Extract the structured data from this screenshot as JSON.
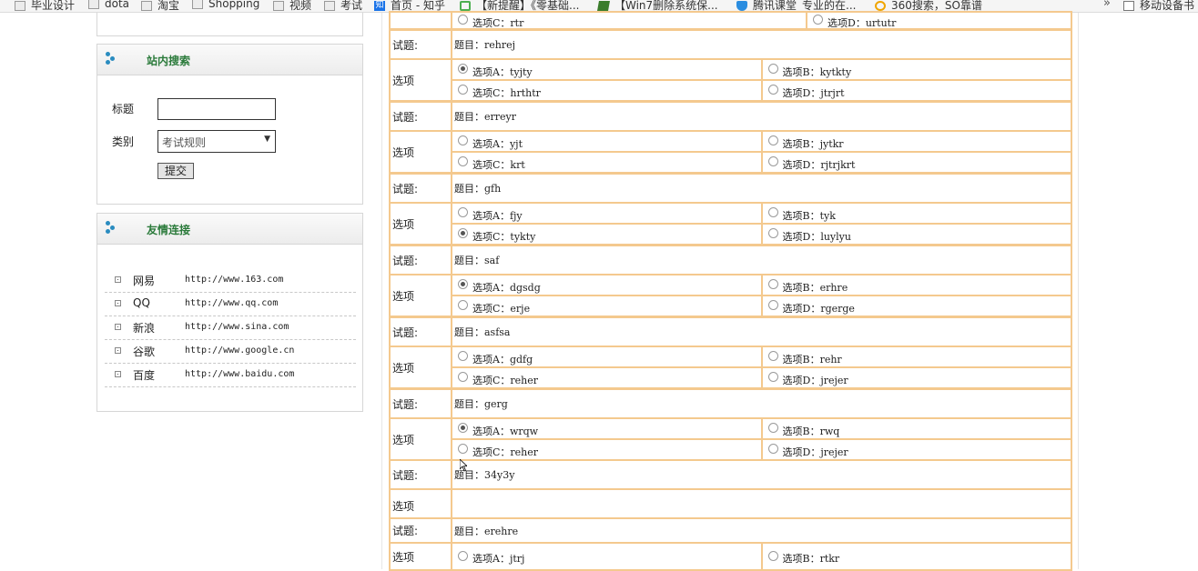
{
  "bookmarks": [
    {
      "label": "毕业设计",
      "icon": "folder-icon"
    },
    {
      "label": "dota",
      "icon": "folder-icon"
    },
    {
      "label": "淘宝",
      "icon": "folder-icon"
    },
    {
      "label": "Shopping",
      "icon": "folder-icon"
    },
    {
      "label": "视频",
      "icon": "folder-icon"
    },
    {
      "label": "考试",
      "icon": "folder-icon"
    },
    {
      "label": "首页 - 知乎",
      "icon": "zhihu-icon"
    },
    {
      "label": "【新提醒】《零基础...",
      "icon": "g-icon"
    },
    {
      "label": "【Win7删除系统保...",
      "icon": "z-icon"
    },
    {
      "label": "腾讯课堂_专业的在...",
      "icon": "shield-icon"
    },
    {
      "label": "360搜索，SO靠谱",
      "icon": "ring-icon"
    }
  ],
  "bookmarks_more": "»",
  "mobile_bookmarks": "移动设备书",
  "search_panel": {
    "title": "站内搜索",
    "title_label": "标题",
    "title_value": "",
    "category_label": "类别",
    "category_value": "考试规则",
    "submit_label": "提交"
  },
  "links_panel": {
    "title": "友情连接",
    "links": [
      {
        "name": "网易",
        "url": "http://www.163.com"
      },
      {
        "name": "QQ",
        "url": "http://www.qq.com"
      },
      {
        "name": "新浪",
        "url": "http://www.sina.com"
      },
      {
        "name": "谷歌",
        "url": "http://www.google.cn"
      },
      {
        "name": "百度",
        "url": "http://www.baidu.com"
      }
    ]
  },
  "exam": {
    "top_partial": {
      "c": "选项C：rtr",
      "d": "选项D：urtutr"
    },
    "questions": [
      {
        "label": "试题:",
        "stem": "题目：rehrej",
        "opt_label": "选项",
        "a": "选项A：tyjty",
        "b": "选项B：kytkty",
        "c": "选项C：hrthtr",
        "d": "选项D：jtrjrt",
        "selected": "A"
      },
      {
        "label": "试题:",
        "stem": "题目：erreyr",
        "opt_label": "选项",
        "a": "选项A：yjt",
        "b": "选项B：jytkr",
        "c": "选项C：krt",
        "d": "选项D：rjtrjkrt",
        "selected": ""
      },
      {
        "label": "试题:",
        "stem": "题目：gfh",
        "opt_label": "选项",
        "a": "选项A：fjy",
        "b": "选项B：tyk",
        "c": "选项C：tykty",
        "d": "选项D：luylyu",
        "selected": "C"
      },
      {
        "label": "试题:",
        "stem": "题目：saf",
        "opt_label": "选项",
        "a": "选项A：dgsdg",
        "b": "选项B：erhre",
        "c": "选项C：erje",
        "d": "选项D：rgerge",
        "selected": "A"
      },
      {
        "label": "试题:",
        "stem": "题目：asfsa",
        "opt_label": "选项",
        "a": "选项A：gdfg",
        "b": "选项B：rehr",
        "c": "选项C：reher",
        "d": "选项D：jrejer",
        "selected": ""
      },
      {
        "label": "试题:",
        "stem": "题目：gerg",
        "opt_label": "选项",
        "a": "选项A：wrqw",
        "b": "选项B：rwq",
        "c": "选项C：reher",
        "d": "选项D：jrejer",
        "selected": "A"
      }
    ],
    "tail": [
      {
        "label": "试题:",
        "stem": "题目：34y3y"
      },
      {
        "label": "选项"
      },
      {
        "label": "试题:",
        "stem": "题目：erehre"
      },
      {
        "label": "选项",
        "a": "选项A：jtrj",
        "b": "选项B：rtkr"
      }
    ]
  }
}
